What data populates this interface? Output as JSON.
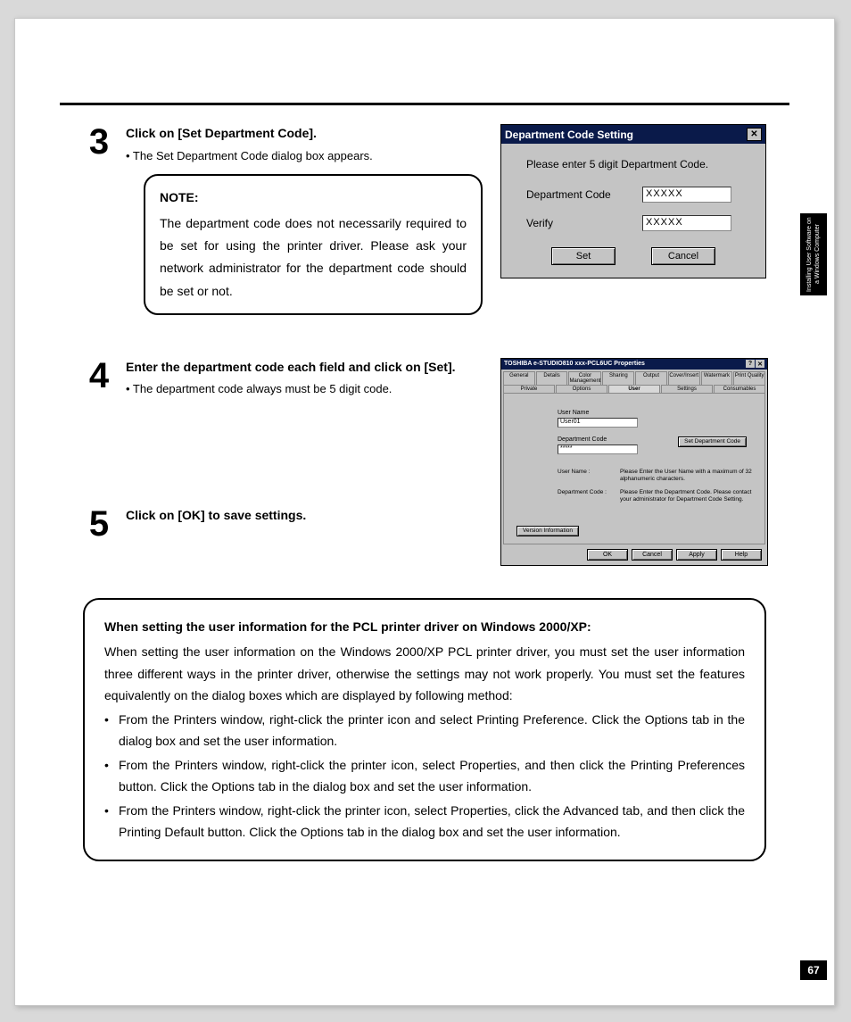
{
  "side_tab": "Installing User\nSoftware on a\nWindows Computer",
  "page_number": "67",
  "step3": {
    "num": "3",
    "title": "Click on [Set Department Code].",
    "sub": "• The Set Department Code dialog box appears.",
    "note_title": "NOTE:",
    "note_body": "The department code does not necessarily required to be set for using the printer driver.  Please ask your network administrator for the department code should be set or not."
  },
  "step4": {
    "num": "4",
    "title": "Enter the department code each field and click on [Set].",
    "sub": "• The department code always must be 5 digit code."
  },
  "step5": {
    "num": "5",
    "title": "Click on [OK] to save settings."
  },
  "dialog_a": {
    "title": "Department Code Setting",
    "close": "✕",
    "message": "Please enter 5 digit Department Code.",
    "label_dept": "Department Code",
    "label_verify": "Verify",
    "value_dept": "XXXXX",
    "value_verify": "XXXXX",
    "btn_set": "Set",
    "btn_cancel": "Cancel"
  },
  "dialog_b": {
    "title": "TOSHIBA e-STUDIO810 xxx-PCL6UC Properties",
    "tabs_row1": [
      "General",
      "Details",
      "Color Management",
      "Sharing",
      "Output",
      "Cover/Insert",
      "Watermark",
      "Print Quality"
    ],
    "tabs_row2": [
      "Private",
      "Options",
      "User",
      "Settings",
      "Consumables"
    ],
    "active_tab": "User",
    "lbl_username": "User Name",
    "val_username": "User01",
    "lbl_deptcode": "Department Code",
    "val_deptcode": "*****",
    "btn_setdept": "Set Department Code",
    "info1_lbl": "User Name :",
    "info1_txt": "Please Enter the User Name with a maximum of 32 alphanumeric characters.",
    "info2_lbl": "Department Code :",
    "info2_txt": "Please Enter the Department Code. Please contact your administrator for Department Code Setting.",
    "btn_version": "Version Information",
    "btn_ok": "OK",
    "btn_cancel": "Cancel",
    "btn_apply": "Apply",
    "btn_help": "Help"
  },
  "big_box": {
    "heading": "When setting the user information for the PCL printer driver on Windows 2000/XP:",
    "intro": "When setting the user information on the Windows 2000/XP PCL printer driver, you must set the user information three different ways in the printer driver, otherwise the settings may not work properly.  You must set the features equivalently on the dialog boxes which are displayed by following method:",
    "b1": "From the Printers window, right-click the printer icon and select Printing Preference.  Click the Options tab in the dialog box and set the user information.",
    "b2": "From the Printers window, right-click the printer icon, select Properties, and then click the Printing Preferences button.  Click the Options tab in the dialog box and set the user information.",
    "b3": "From the Printers window, right-click the printer icon, select Properties, click the Advanced tab, and then click the Printing Default button.  Click the Options tab in the dialog box and set the user information."
  }
}
